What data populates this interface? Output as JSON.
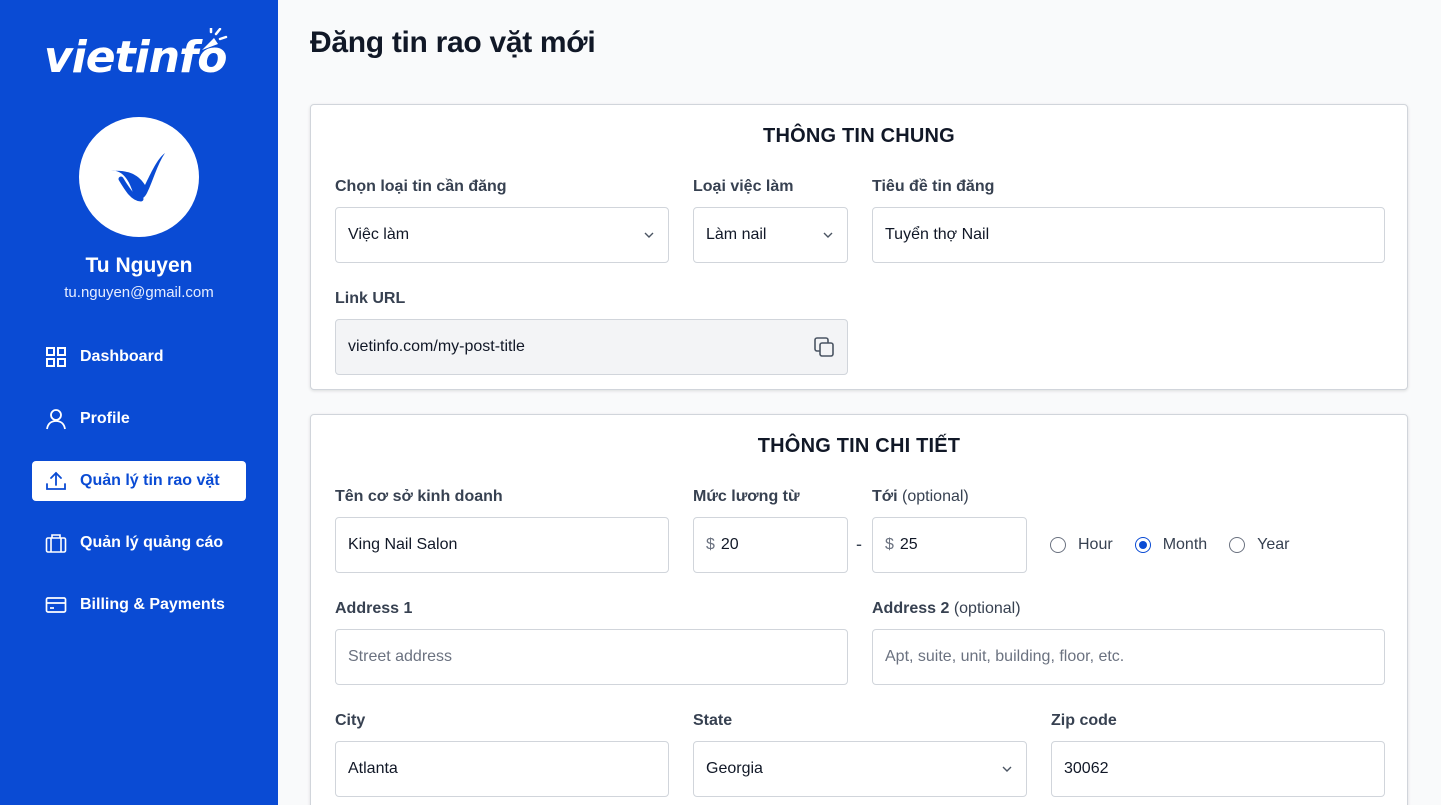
{
  "brand": {
    "logo_text": "vietinfo",
    "primary_color": "#0a4bd4"
  },
  "user": {
    "name": "Tu Nguyen",
    "email": "tu.nguyen@gmail.com"
  },
  "sidebar": {
    "items": [
      {
        "label": "Dashboard",
        "icon": "grid-icon",
        "active": false
      },
      {
        "label": "Profile",
        "icon": "user-icon",
        "active": false
      },
      {
        "label": "Quản lý tin rao vặt",
        "icon": "upload-icon",
        "active": true
      },
      {
        "label": "Quản lý quảng cáo",
        "icon": "briefcase-icon",
        "active": false
      },
      {
        "label": "Billing & Payments",
        "icon": "credit-card-icon",
        "active": false
      }
    ]
  },
  "page": {
    "title": "Đăng tin rao vặt mới"
  },
  "general": {
    "title": "THÔNG TIN CHUNG",
    "post_type": {
      "label": "Chọn loại tin cần đăng",
      "value": "Việc làm"
    },
    "job_type": {
      "label": "Loại việc làm",
      "value": "Làm nail"
    },
    "post_title": {
      "label": "Tiêu đề tin đăng",
      "value": "Tuyển thợ Nail"
    },
    "link_url": {
      "label": "Link URL",
      "value": "vietinfo.com/my-post-title"
    }
  },
  "detail": {
    "title": "THÔNG TIN CHI TIẾT",
    "business": {
      "label": "Tên cơ sở kinh doanh",
      "value": "King Nail Salon"
    },
    "salary_from": {
      "label": "Mức lương từ",
      "currency": "$",
      "value": "20"
    },
    "salary_to": {
      "label": "Tới",
      "optional": "(optional)",
      "currency": "$",
      "value": "25"
    },
    "separator": "-",
    "period": {
      "options": [
        "Hour",
        "Month",
        "Year"
      ],
      "selected": "Month"
    },
    "address1": {
      "label": "Address 1",
      "placeholder": "Street address"
    },
    "address2": {
      "label": "Address 2",
      "optional": "(optional)",
      "placeholder": "Apt, suite, unit, building, floor, etc."
    },
    "city": {
      "label": "City",
      "value": "Atlanta"
    },
    "state": {
      "label": "State",
      "value": "Georgia"
    },
    "zip": {
      "label": "Zip code",
      "value": "30062"
    }
  }
}
